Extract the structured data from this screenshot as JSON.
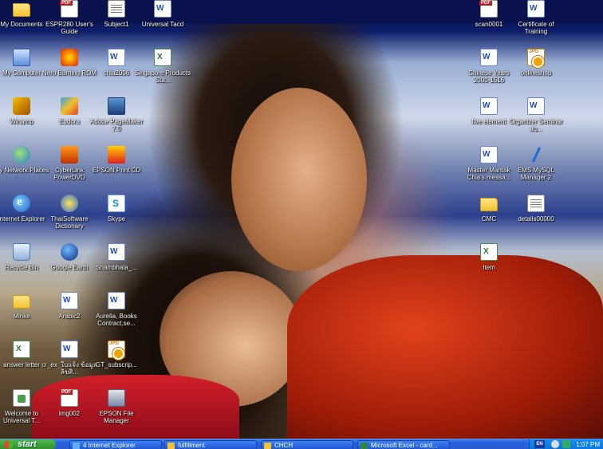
{
  "desktop": {
    "icons": [
      {
        "label": "My Documents",
        "glyph": "folder"
      },
      {
        "label": "ESPR280 User's Guide",
        "glyph": "pdf"
      },
      {
        "label": "Subject1",
        "glyph": "txt"
      },
      {
        "label": "Universal Tacd",
        "glyph": "doc"
      },
      {
        "label": "scan0001",
        "glyph": "pdf"
      },
      {
        "label": "Certificate of Training",
        "glyph": "doc"
      },
      {
        "label": "My Computer",
        "glyph": "pc"
      },
      {
        "label": "Nero Burning ROM",
        "glyph": "nero"
      },
      {
        "label": "chia2006",
        "glyph": "doc"
      },
      {
        "label": "Singapore Products Sta...",
        "glyph": "xls"
      },
      {
        "label": "Chinese Years 2000-1516",
        "glyph": "doc"
      },
      {
        "label": "onlineshop",
        "glyph": "jpg"
      },
      {
        "label": "Winamp",
        "glyph": "winamp"
      },
      {
        "label": "Eudora",
        "glyph": "eudora"
      },
      {
        "label": "Adobe PageMaker 7.0",
        "glyph": "pm"
      },
      {
        "label": "five element",
        "glyph": "doc"
      },
      {
        "label": "Organizer Seminar ag...",
        "glyph": "doc"
      },
      {
        "label": "My Network Places",
        "glyph": "net"
      },
      {
        "label": "CyberLink PowerDVD",
        "glyph": "dvd"
      },
      {
        "label": "EPSON Print CD",
        "glyph": "print"
      },
      {
        "label": "Master Mantak Chia's messa...",
        "glyph": "doc"
      },
      {
        "label": "EMS MySQL Manager 2",
        "glyph": "mysql"
      },
      {
        "label": "Internet Explorer",
        "glyph": "ie"
      },
      {
        "label": "ThaiSoftware Dictionary",
        "glyph": "thai"
      },
      {
        "label": "Skype",
        "glyph": "skype"
      },
      {
        "label": "CMC",
        "glyph": "folder"
      },
      {
        "label": "details00000",
        "glyph": "txt"
      },
      {
        "label": "Recycle Bin",
        "glyph": "bin"
      },
      {
        "label": "Google Earth",
        "glyph": "earth"
      },
      {
        "label": "Shambhala_...",
        "glyph": "doc"
      },
      {
        "label": "Item",
        "glyph": "xls"
      },
      {
        "label": "Minke",
        "glyph": "folder"
      },
      {
        "label": "Arabic2",
        "glyph": "doc"
      },
      {
        "label": "Aurelia, Books Contract,se...",
        "glyph": "doc"
      },
      {
        "label": "answer letter",
        "glyph": "xls"
      },
      {
        "label": "cr_ex_ใบแจ้ง ข้อมูลลิขสิ...",
        "glyph": "doc"
      },
      {
        "label": "GT_subscrip...",
        "glyph": "jpg"
      },
      {
        "label": "Welcome to Universal T...",
        "glyph": "gif"
      },
      {
        "label": "img002",
        "glyph": "pdf"
      },
      {
        "label": "EPSON File Manager",
        "glyph": "efm"
      }
    ]
  },
  "taskbar": {
    "start_label": "start",
    "buttons": [
      {
        "label": "4 Internet Explorer"
      },
      {
        "label": "fulfillment"
      },
      {
        "label": "CHCH"
      },
      {
        "label": "Microsoft Excel - card..."
      }
    ],
    "lang": "EN",
    "clock": "1:07 PM"
  },
  "colors": {
    "taskbar": "#245edb",
    "start": "#3c9a3a",
    "tray": "#0c73dd"
  }
}
